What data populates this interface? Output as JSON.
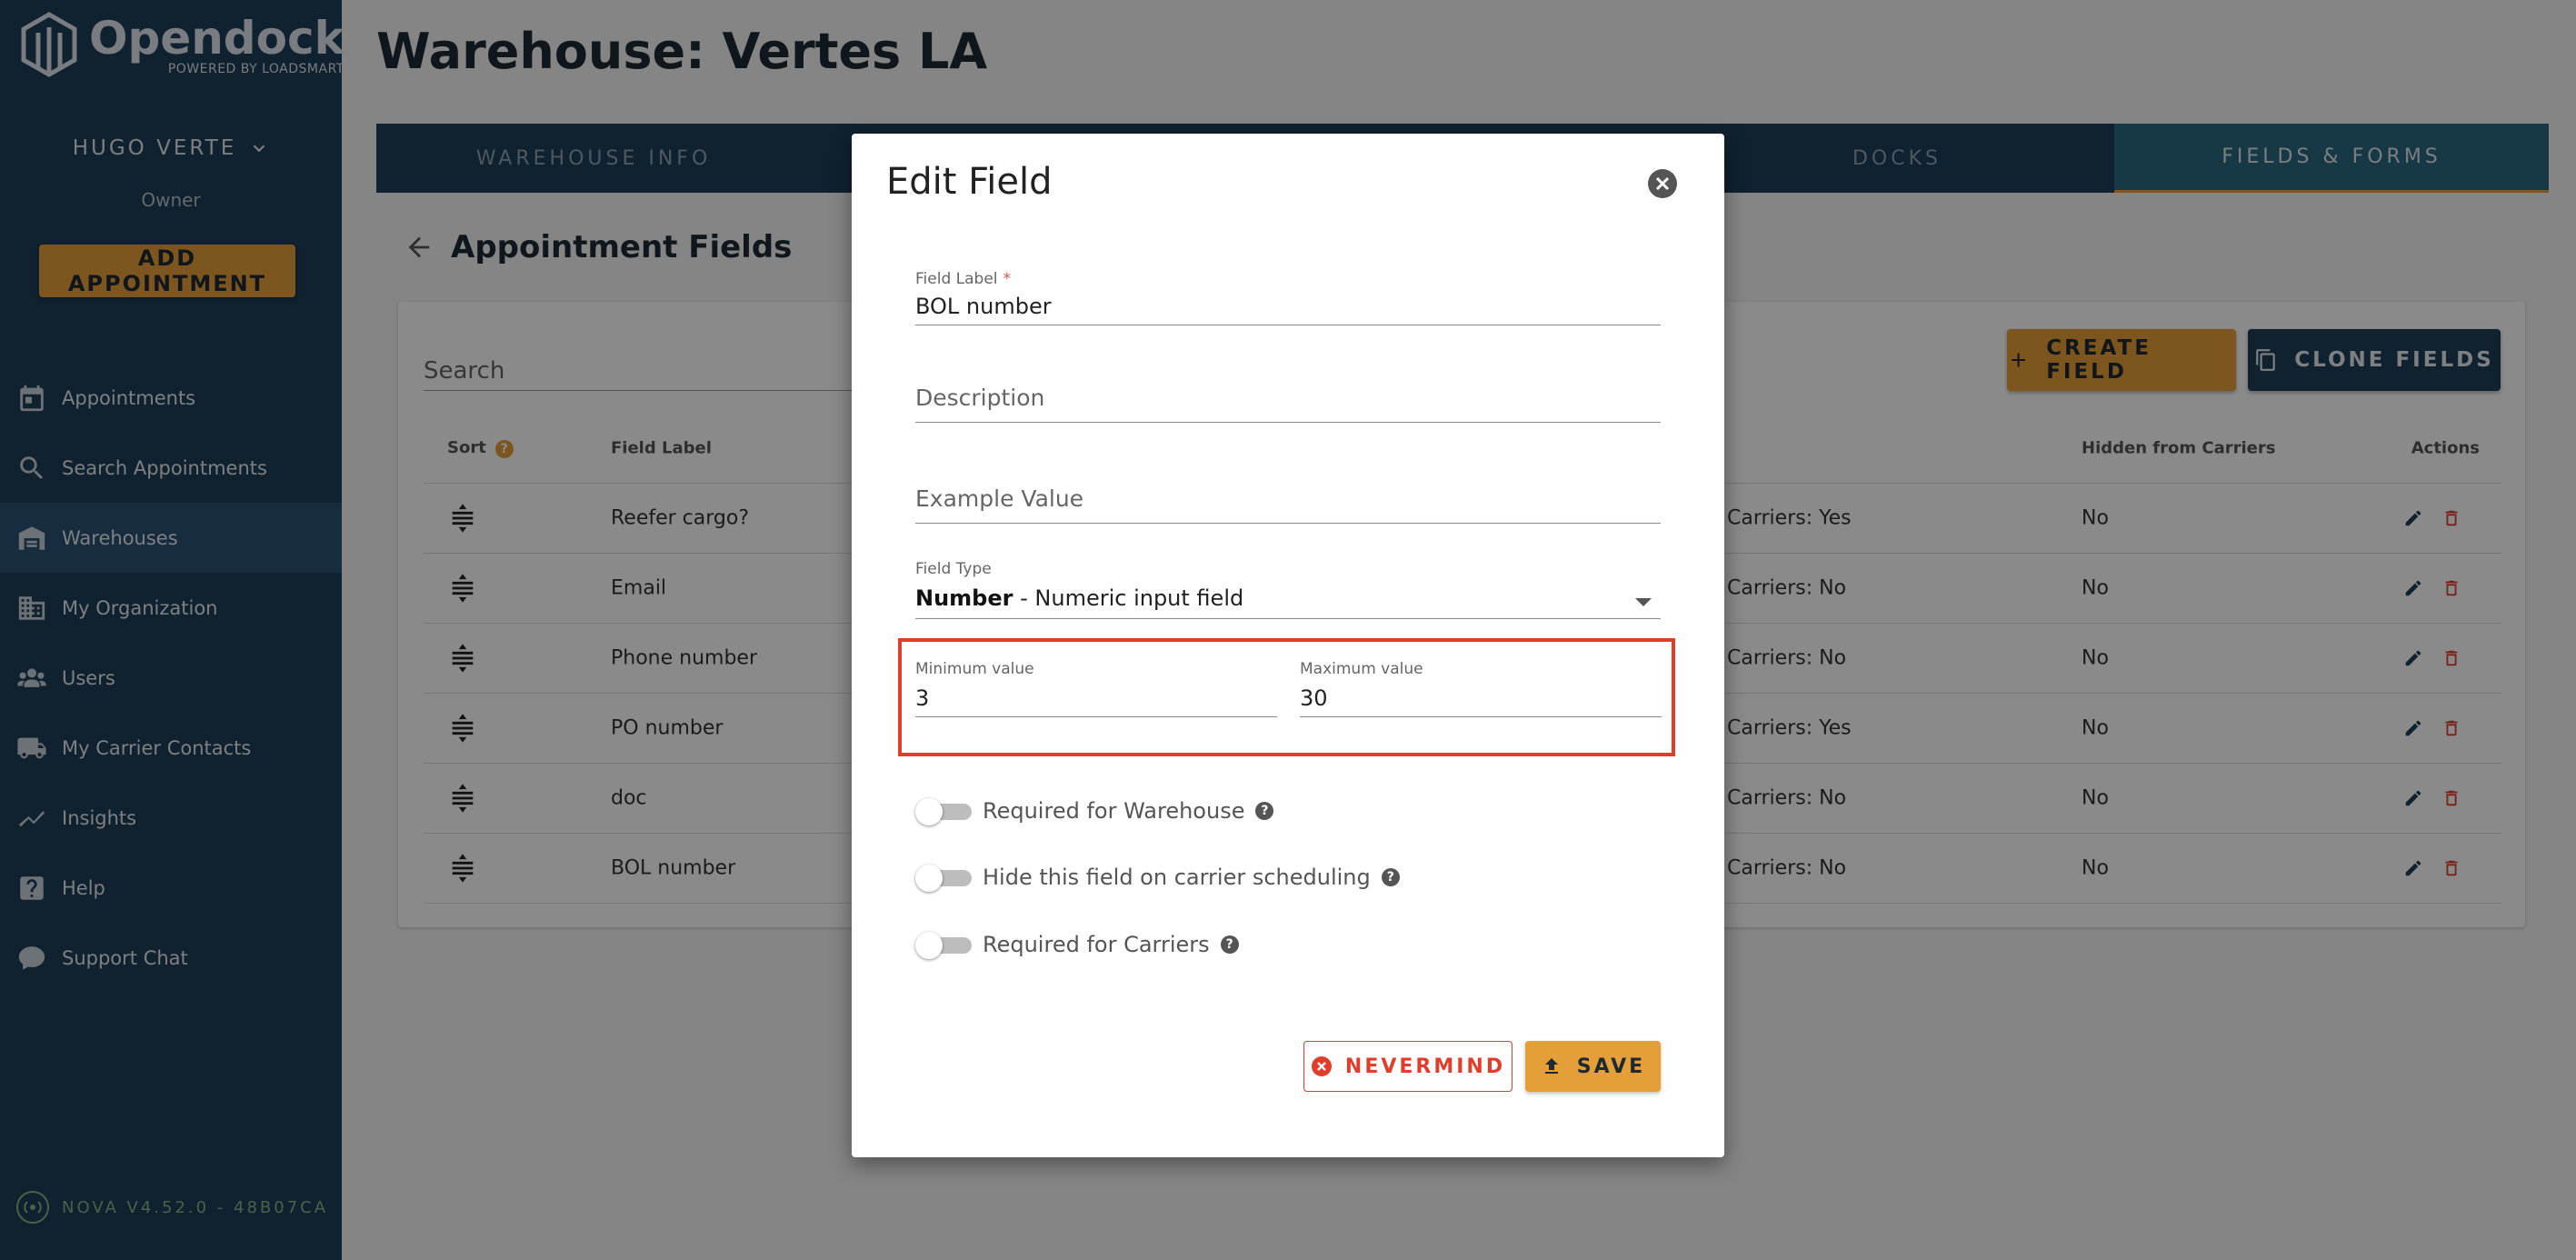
{
  "sidebar": {
    "logo_name": "Opendock",
    "logo_sub": "POWERED BY LOADSMART",
    "user_name": "HUGO VERTE",
    "user_role": "Owner",
    "add_appointment_label": "ADD APPOINTMENT",
    "items": [
      {
        "label": "Appointments",
        "icon": "calendar-icon"
      },
      {
        "label": "Search Appointments",
        "icon": "search-icon"
      },
      {
        "label": "Warehouses",
        "icon": "warehouse-icon",
        "active": true
      },
      {
        "label": "My Organization",
        "icon": "building-icon"
      },
      {
        "label": "Users",
        "icon": "users-icon"
      },
      {
        "label": "My Carrier Contacts",
        "icon": "truck-icon"
      },
      {
        "label": "Insights",
        "icon": "chart-icon"
      },
      {
        "label": "Help",
        "icon": "help-icon"
      },
      {
        "label": "Support Chat",
        "icon": "chat-icon"
      }
    ],
    "version": "NOVA V4.52.0 - 48B07CA"
  },
  "main": {
    "page_title": "Warehouse: Vertes LA",
    "tabs": [
      {
        "label": "WAREHOUSE INFO"
      },
      {
        "label": ""
      },
      {
        "label": ""
      },
      {
        "label": "DOCKS"
      },
      {
        "label": "FIELDS & FORMS",
        "active": true
      }
    ],
    "section_title": "Appointment Fields",
    "search_placeholder": "Search",
    "create_field_label": "CREATE FIELD",
    "clone_fields_label": "CLONE FIELDS",
    "table": {
      "headers": {
        "sort": "Sort",
        "field_label": "Field Label",
        "hidden": "Hidden from Carriers",
        "actions": "Actions"
      },
      "rows": [
        {
          "label": "Reefer cargo?",
          "partial": "Carriers: Yes",
          "hidden": "No"
        },
        {
          "label": "Email",
          "partial": "Carriers: No",
          "hidden": "No"
        },
        {
          "label": "Phone number",
          "partial": "Carriers: No",
          "hidden": "No"
        },
        {
          "label": "PO number",
          "partial": "Carriers: Yes",
          "hidden": "No"
        },
        {
          "label": "doc",
          "partial": "Carriers: No",
          "hidden": "No"
        },
        {
          "label": "BOL number",
          "partial": "Carriers: No",
          "hidden": "No"
        }
      ]
    }
  },
  "modal": {
    "title": "Edit Field",
    "field_label": {
      "label": "Field Label",
      "required_mark": "*",
      "value": "BOL number"
    },
    "description_placeholder": "Description",
    "example_placeholder": "Example Value",
    "field_type": {
      "label": "Field Type",
      "value_bold": "Number",
      "value_rest": " - Numeric input field"
    },
    "min": {
      "label": "Minimum value",
      "value": "3"
    },
    "max": {
      "label": "Maximum value",
      "value": "30"
    },
    "toggles": [
      {
        "label": "Required for Warehouse",
        "on": false
      },
      {
        "label": "Hide this field on carrier scheduling",
        "on": false
      },
      {
        "label": "Required for Carriers",
        "on": false
      }
    ],
    "nevermind_label": "NEVERMIND",
    "save_label": "SAVE",
    "highlight_color": "#e13d2b"
  },
  "colors": {
    "sidebar_bg": "#1e3e57",
    "accent": "#e59f39",
    "danger": "#e13d2b"
  }
}
